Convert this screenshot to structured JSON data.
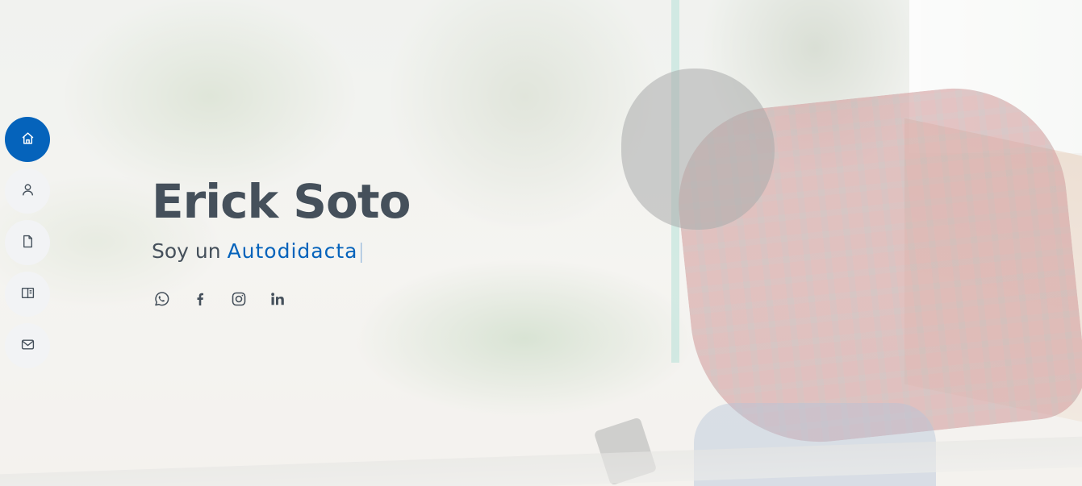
{
  "hero": {
    "name": "Erick Soto",
    "subtitle_prefix": "Soy un",
    "typed_text": "Autodidacta",
    "cursor": "|"
  },
  "side_nav": {
    "items": [
      {
        "icon": "home-icon",
        "active": true
      },
      {
        "icon": "user-icon",
        "active": false
      },
      {
        "icon": "file-icon",
        "active": false
      },
      {
        "icon": "book-icon",
        "active": false
      },
      {
        "icon": "envelope-icon",
        "active": false
      }
    ]
  },
  "social_links": [
    {
      "icon": "whatsapp-icon"
    },
    {
      "icon": "facebook-icon"
    },
    {
      "icon": "instagram-icon"
    },
    {
      "icon": "linkedin-icon"
    }
  ],
  "colors": {
    "accent": "#0563bb",
    "text": "#45505b",
    "nav_bg": "#f2f3f5"
  }
}
